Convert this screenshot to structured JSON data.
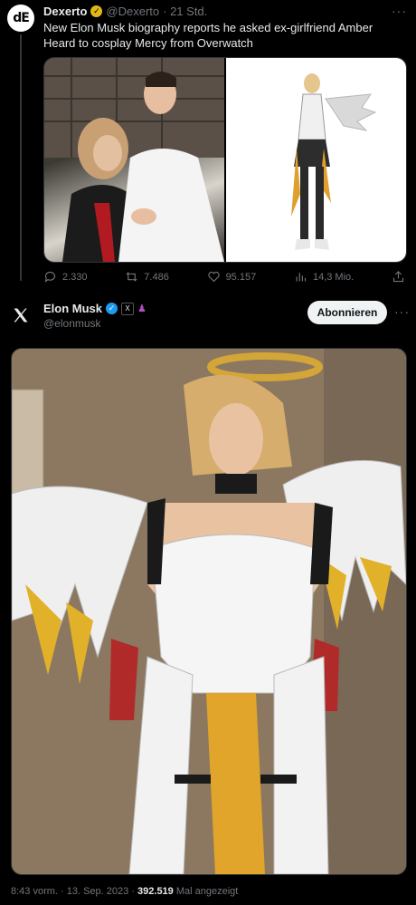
{
  "tweet1": {
    "author_name": "Dexerto",
    "author_handle": "@Dexerto",
    "time": "· 21 Std.",
    "text": "New Elon Musk biography reports he asked ex-girlfriend Amber Heard to cosplay Mercy from Overwatch",
    "stats": {
      "replies": "2.330",
      "retweets": "7.486",
      "likes": "95.157",
      "views": "14,3 Mio."
    }
  },
  "tweet2": {
    "author_name": "Elon Musk",
    "author_handle": "@elonmusk",
    "follow_label": "Abonnieren",
    "timestamp": "8:43 vorm. · 13. Sep. 2023 ·",
    "views_count": "392.519",
    "views_label": "Mal angezeigt"
  },
  "colors": {
    "background": "#000000",
    "text": "#e7e9ea",
    "muted": "#71767b",
    "gold_badge": "#e2b719",
    "blue_badge": "#1d9bf0"
  },
  "icons": [
    "reply-icon",
    "retweet-icon",
    "like-icon",
    "views-icon",
    "share-icon",
    "x-logo-icon",
    "verified-badge-icon",
    "more-icon"
  ]
}
